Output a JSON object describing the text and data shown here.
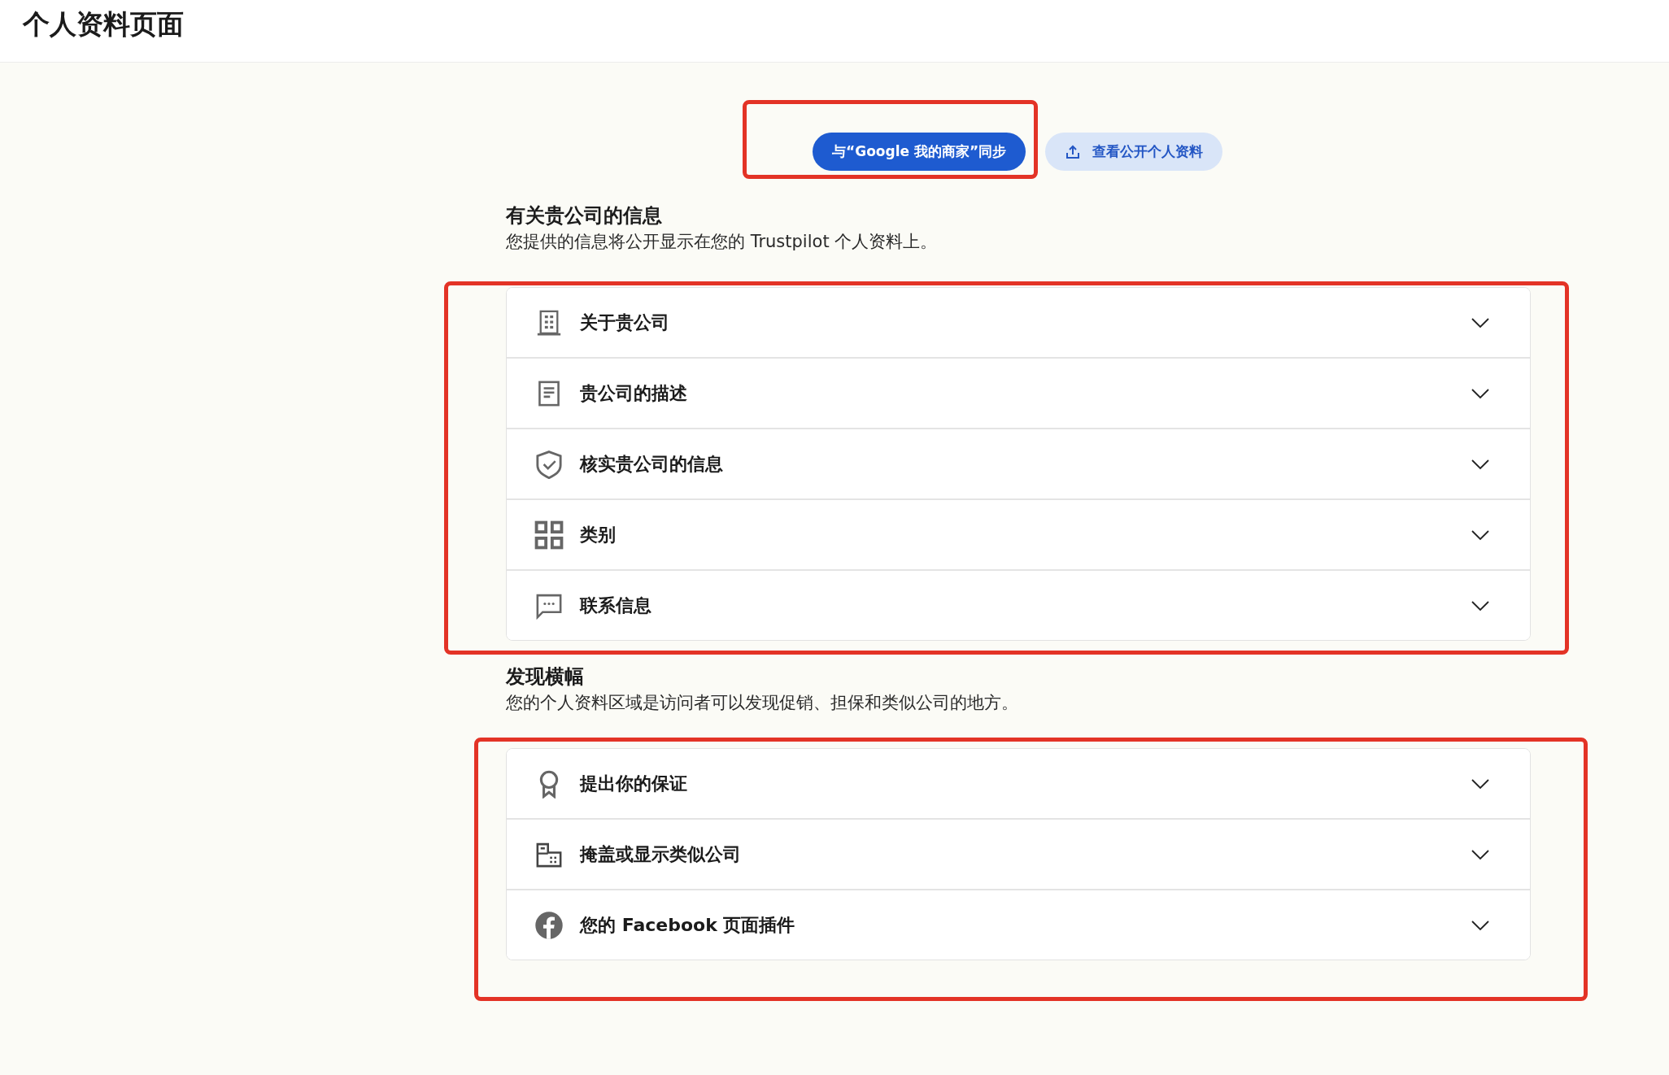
{
  "header": {
    "title": "个人资料页面"
  },
  "actions": [
    {
      "label": "与“Google 我的商家”同步",
      "kind": "primary",
      "highlighted": true
    },
    {
      "label": "查看公开个人资料",
      "kind": "secondary",
      "highlighted": false
    }
  ],
  "sections": [
    {
      "title": "有关贵公司的信息",
      "subtitle": "您提供的信息将公开显示在您的 Trustpilot 个人资料上。",
      "highlighted": true,
      "items": [
        {
          "label": "关于贵公司",
          "kind": "building",
          "expanded": false
        },
        {
          "label": "贵公司的描述",
          "kind": "document",
          "expanded": false
        },
        {
          "label": "核实贵公司的信息",
          "kind": "shield",
          "expanded": false
        },
        {
          "label": "类别",
          "kind": "grid",
          "expanded": false
        },
        {
          "label": "联系信息",
          "kind": "chat",
          "expanded": false
        }
      ]
    },
    {
      "title": "发现横幅",
      "subtitle": "您的个人资料区域是访问者可以发现促销、担保和类似公司的地方。",
      "highlighted": true,
      "items": [
        {
          "label": "提出你的保证",
          "kind": "award",
          "expanded": false
        },
        {
          "label": "掩盖或显示类似公司",
          "kind": "buildings",
          "expanded": false
        },
        {
          "label": "您的 **Facebook** 页面插件",
          "kind": "facebook",
          "expanded": false
        }
      ]
    }
  ]
}
